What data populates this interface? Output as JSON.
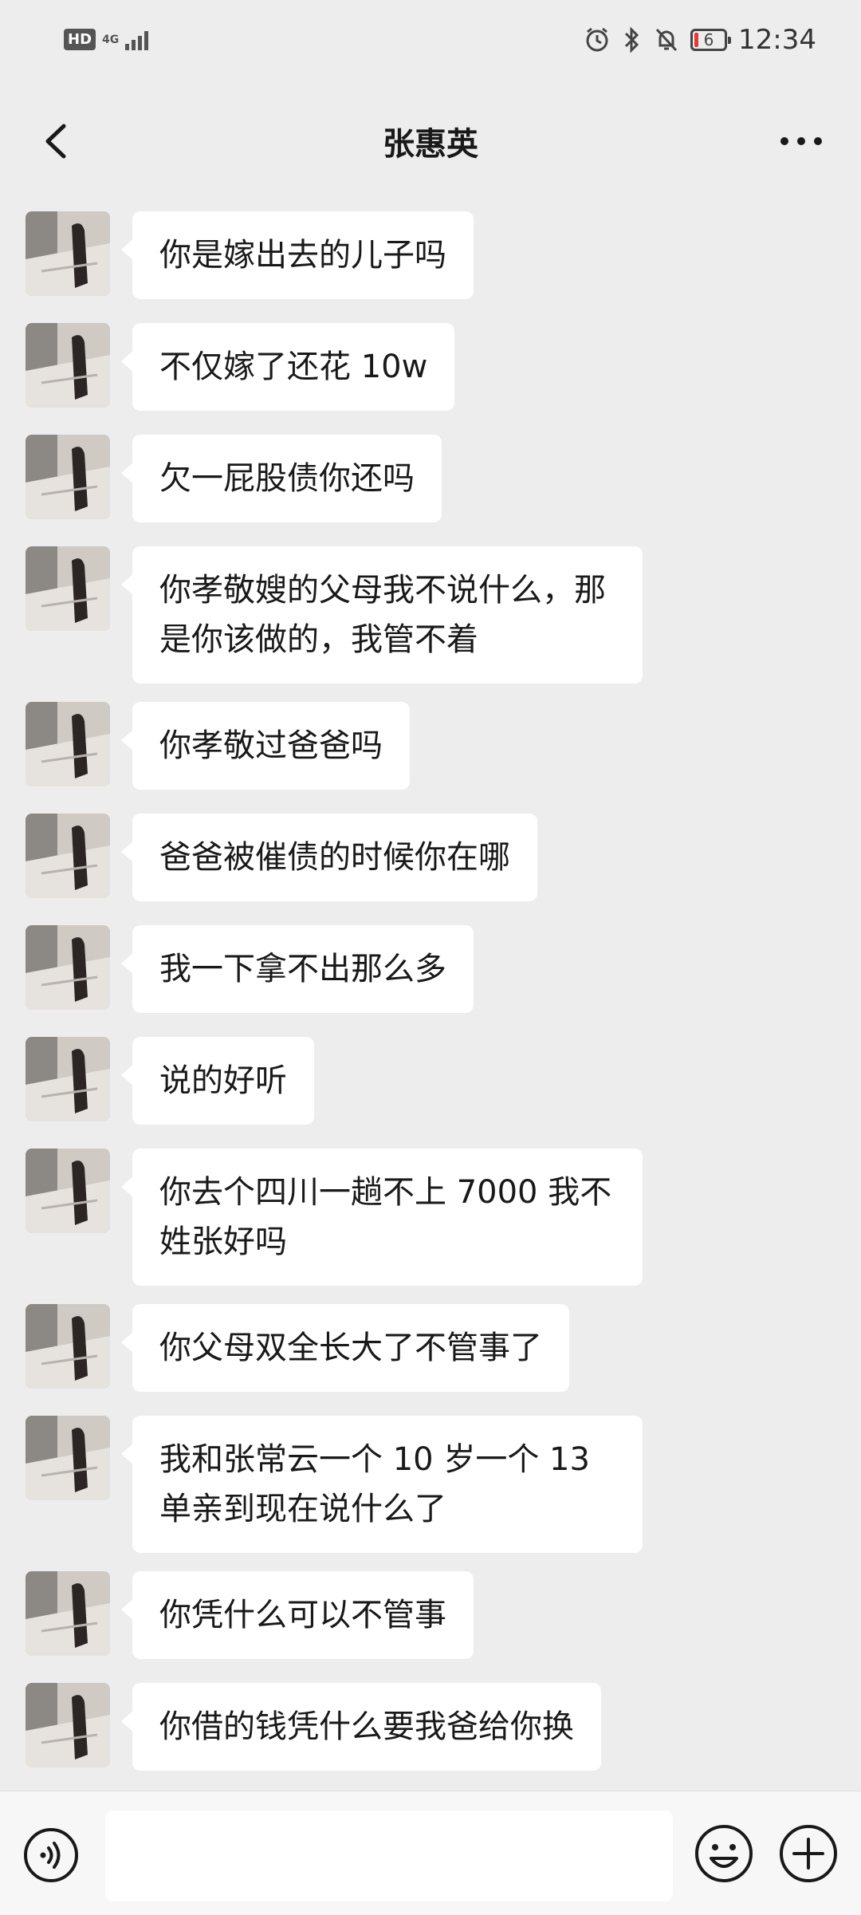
{
  "status_bar": {
    "hd_label": "HD",
    "network_label": "4G",
    "time": "12:34",
    "battery_level": "6"
  },
  "header": {
    "title": "张惠英"
  },
  "messages": [
    {
      "text": "你是嫁出去的儿子吗"
    },
    {
      "text": "不仅嫁了还花 10w"
    },
    {
      "text": "欠一屁股债你还吗"
    },
    {
      "text": "你孝敬嫂的父母我不说什么，那是你该做的，我管不着"
    },
    {
      "text": "你孝敬过爸爸吗"
    },
    {
      "text": "爸爸被催债的时候你在哪"
    },
    {
      "text": "我一下拿不出那么多"
    },
    {
      "text": "说的好听"
    },
    {
      "text": "你去个四川一趟不上 7000 我不姓张好吗"
    },
    {
      "text": "你父母双全长大了不管事了"
    },
    {
      "text": "我和张常云一个 10 岁一个 13 单亲到现在说什么了"
    },
    {
      "text": "你凭什么可以不管事"
    },
    {
      "text": "你借的钱凭什么要我爸给你换"
    }
  ],
  "input": {
    "value": ""
  }
}
